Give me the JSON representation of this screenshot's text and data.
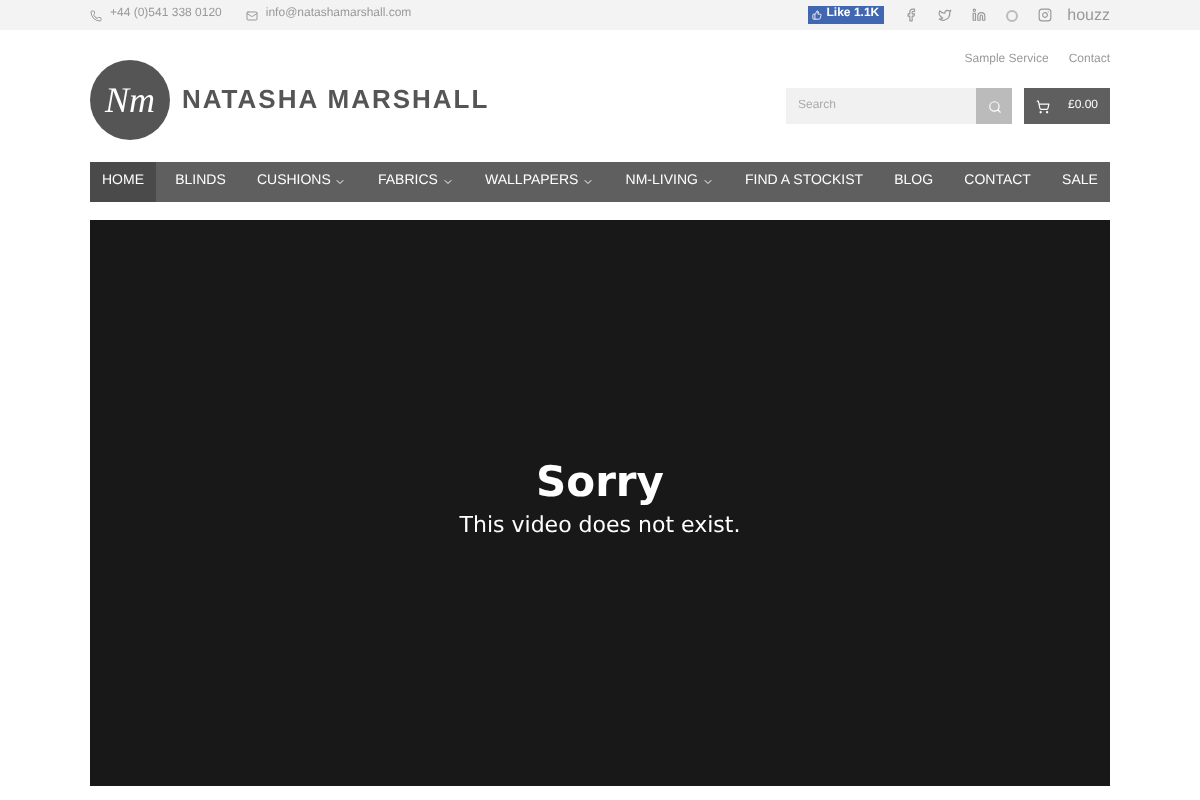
{
  "top_bar": {
    "phone": "+44 (0)541 338 0120",
    "email": "info@natashamarshall.com",
    "like": {
      "label": "Like",
      "count": "1.1K"
    },
    "houzz": "houzz"
  },
  "logo": {
    "monogram": "Nm",
    "name": "NATASHA MARSHALL"
  },
  "header_links": [
    "Sample Service",
    "Contact"
  ],
  "search": {
    "placeholder": "Search"
  },
  "cart": {
    "total": "£0.00"
  },
  "nav": [
    {
      "label": "HOME",
      "selected": true,
      "dropdown": false
    },
    {
      "label": "BLINDS",
      "selected": false,
      "dropdown": false
    },
    {
      "label": "CUSHIONS",
      "selected": false,
      "dropdown": true
    },
    {
      "label": "FABRICS",
      "selected": false,
      "dropdown": true
    },
    {
      "label": "WALLPAPERS",
      "selected": false,
      "dropdown": true
    },
    {
      "label": "NM-LIVING",
      "selected": false,
      "dropdown": true
    },
    {
      "label": "FIND A STOCKIST",
      "selected": false,
      "dropdown": false
    },
    {
      "label": "BLOG",
      "selected": false,
      "dropdown": false
    },
    {
      "label": "CONTACT",
      "selected": false,
      "dropdown": false
    },
    {
      "label": "SALE",
      "selected": false,
      "dropdown": false
    }
  ],
  "video": {
    "title": "Sorry",
    "message": "This video does not exist."
  }
}
